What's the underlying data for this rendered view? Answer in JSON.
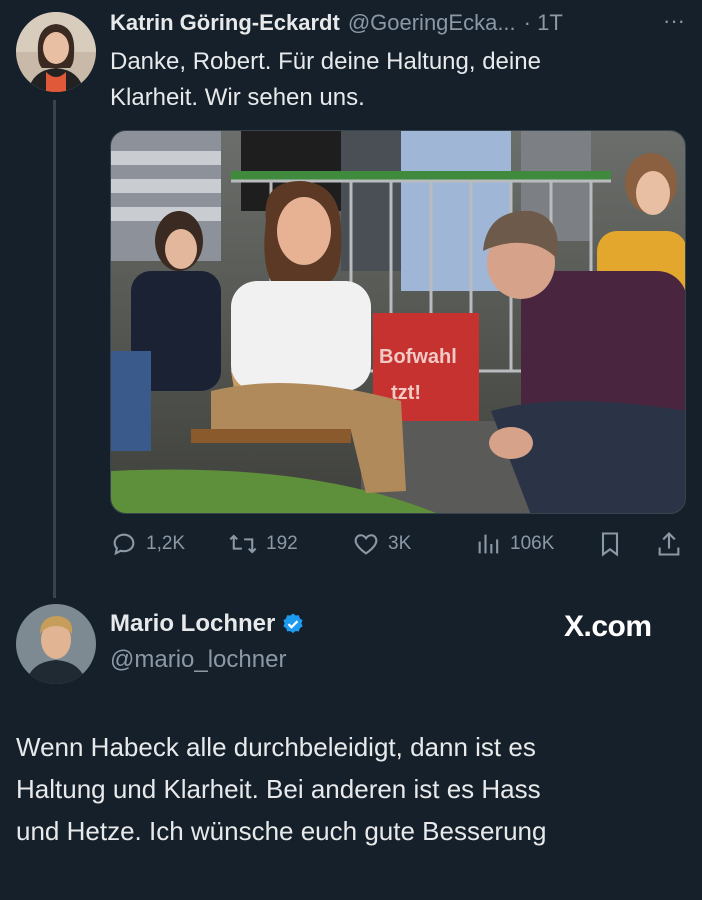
{
  "tweet": {
    "author_name": "Katrin Göring-Eckardt",
    "author_handle": "@GoeringEcka...",
    "time": "· 1T",
    "more_label": "···",
    "text_line1": "Danke, Robert. Für deine Haltung, deine",
    "text_line2": "Klarheit. Wir sehen uns.",
    "image_sign_text1": "Bofwahl",
    "image_sign_text2": "tzt!",
    "actions": {
      "replies": "1,2K",
      "retweets": "192",
      "likes": "3K",
      "views": "106K"
    }
  },
  "reply": {
    "author_name": "Mario Lochner",
    "author_handle": "@mario_lochner",
    "verified_color": "#1d9bf0",
    "site_label": "X.com",
    "text_line1": "Wenn Habeck alle durchbeleidigt, dann ist es",
    "text_line2": "Haltung und Klarheit. Bei anderen ist es Hass",
    "text_line3": "und Hetze. Ich wünsche euch gute Besserung"
  },
  "colors": {
    "background": "#15202b",
    "muted": "#8b98a5",
    "thread_line": "#38444d"
  }
}
